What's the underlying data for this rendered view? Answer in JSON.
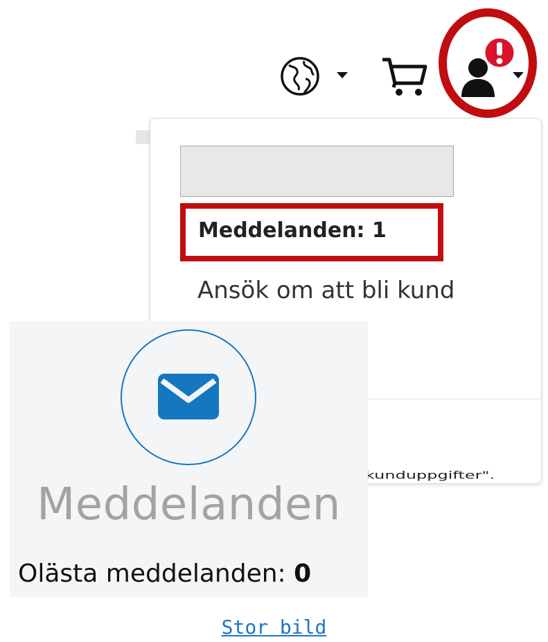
{
  "header": {
    "globe_icon": "globe-icon",
    "cart_icon": "shopping-cart-icon",
    "user_icon": "user-account-icon",
    "alert_icon": "exclamation-badge-icon",
    "alert_badge_color": "#d8132a",
    "highlight_color": "#c00d10"
  },
  "dropdown": {
    "messages_label": "Meddelanden: 1",
    "apply_label": "Ansök om att bli kund",
    "partial_text": "kunduppgifter\"."
  },
  "card": {
    "icon": "envelope-icon",
    "title": "Meddelanden",
    "unread_label": "Olästa meddelanden: ",
    "unread_count": "0",
    "accent_color": "#1577c0"
  },
  "caption": {
    "link_text": "Stor bild"
  }
}
